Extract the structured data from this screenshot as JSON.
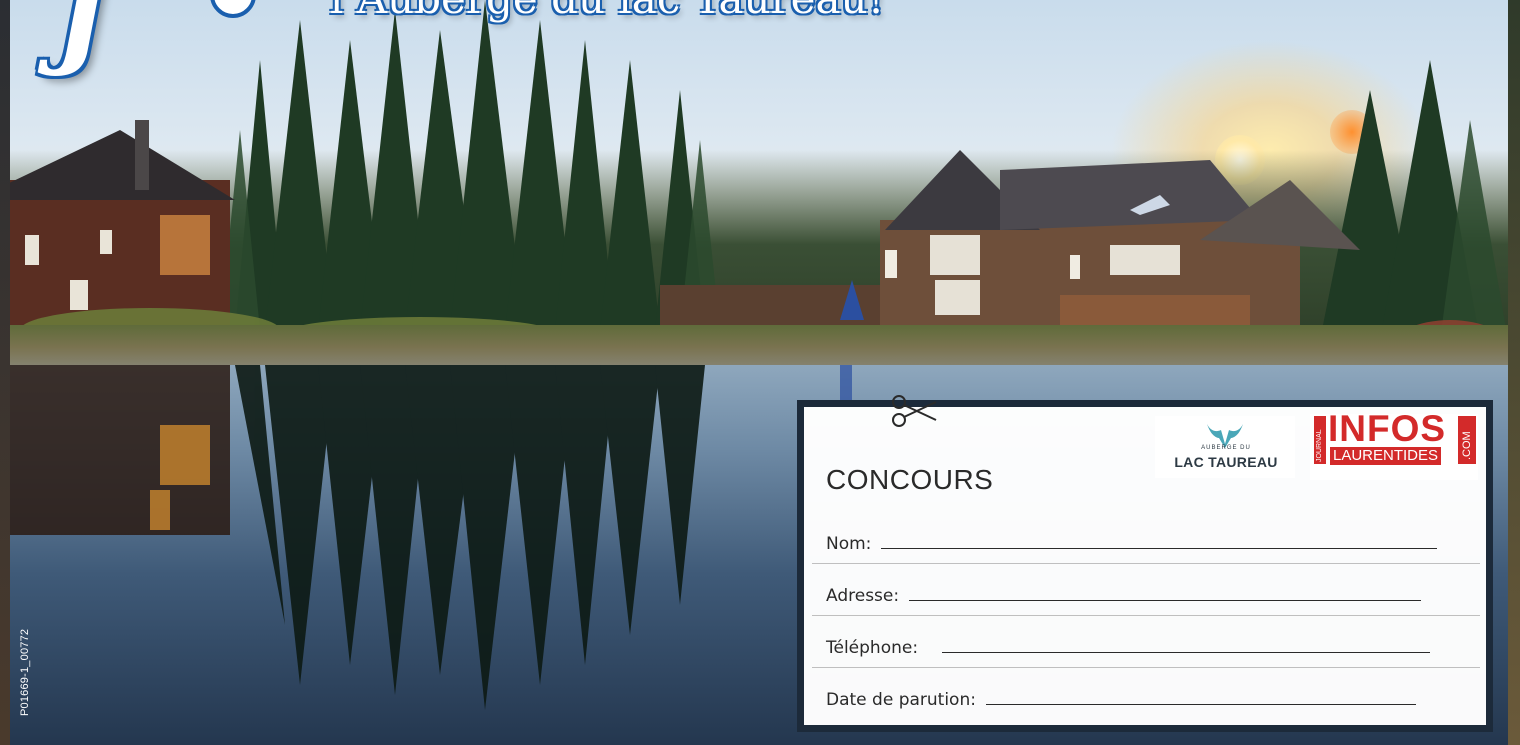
{
  "headline": {
    "initial": "J",
    "text": "l’Auberge du lac Taureau!"
  },
  "reference_code": "P01669-1_00772",
  "coupon": {
    "title": "CONCOURS",
    "fields": [
      {
        "label": "Nom:"
      },
      {
        "label": "Adresse:"
      },
      {
        "label": "Téléphone:"
      },
      {
        "label": "Date de parution:"
      }
    ]
  },
  "logos": {
    "lac_taureau": {
      "small_text": "AUBERGE DU",
      "name": "LAC TAUREAU"
    },
    "infos_laurentides": {
      "journal": "JOURNAL",
      "word": "INFOS",
      "sub": "LAURENTIDES",
      "com": ".COM"
    }
  },
  "colors": {
    "headline_blue": "#1a5fae",
    "coupon_dash": "#57b8dd",
    "coupon_frame": "#1c2a3a",
    "infos_red": "#d32a2a"
  },
  "icons": {
    "scissors": "scissors-icon"
  }
}
